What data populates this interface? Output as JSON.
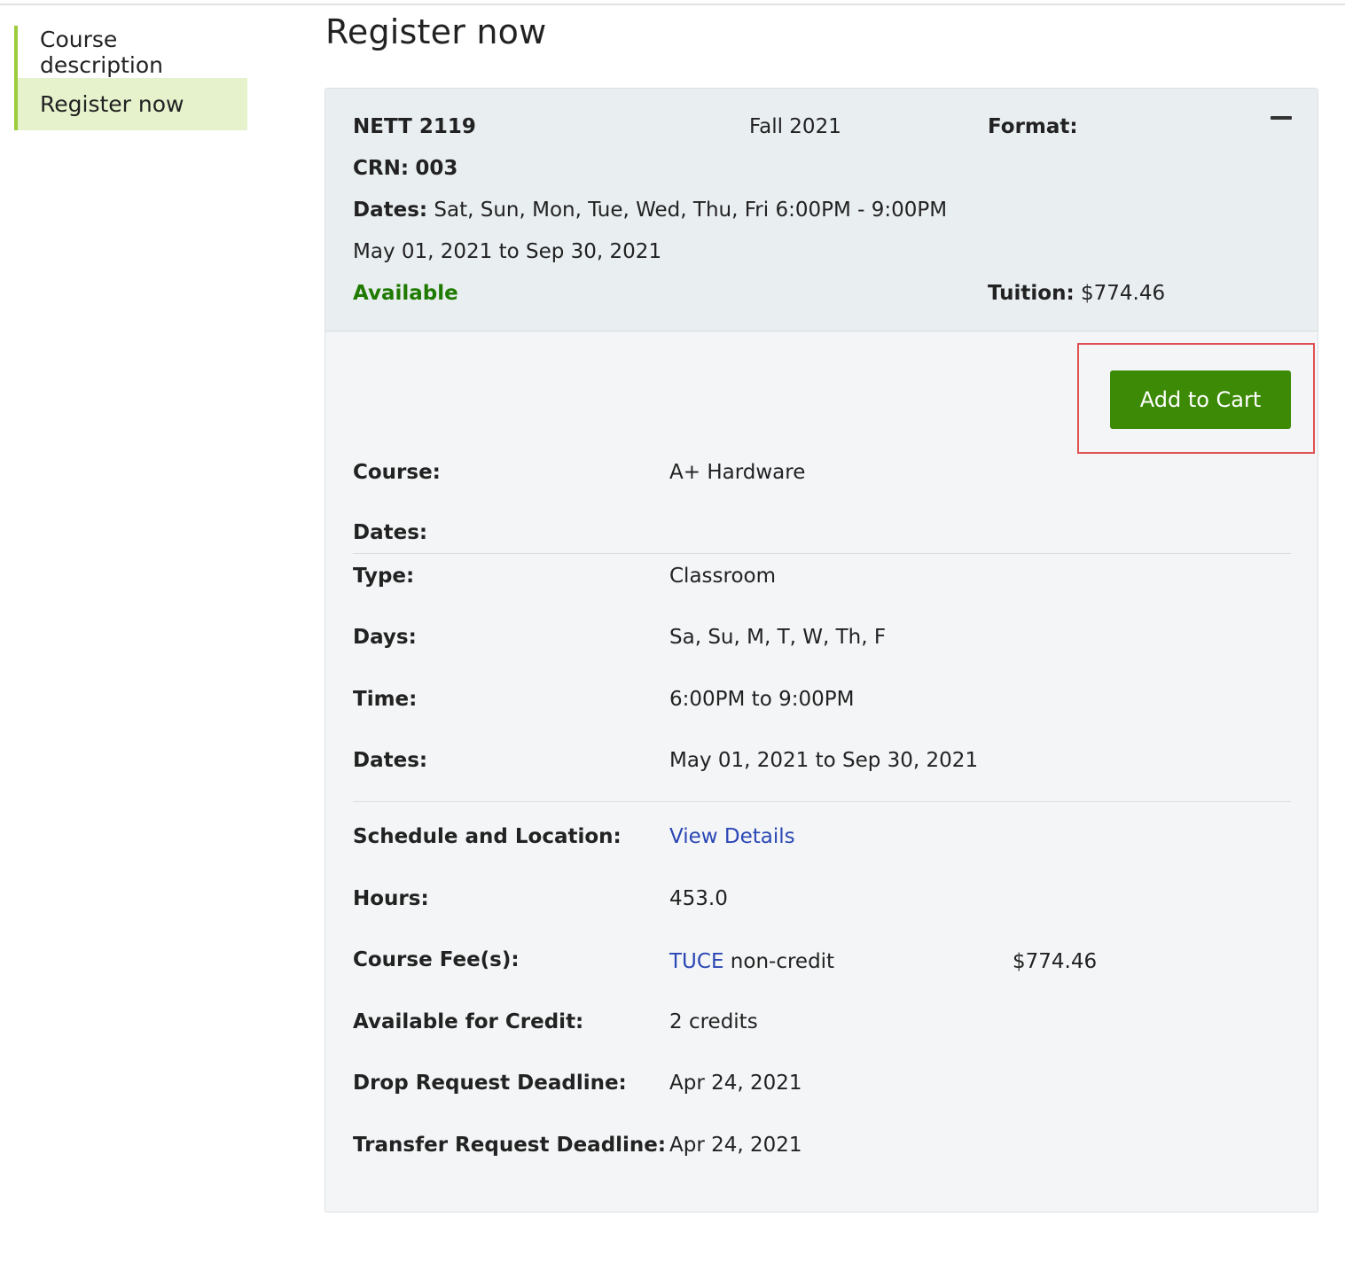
{
  "sidebar": {
    "items": [
      {
        "label": "Course description",
        "active": false
      },
      {
        "label": "Register now",
        "active": true
      }
    ]
  },
  "page": {
    "title": "Register now"
  },
  "section": {
    "course_code": "NETT 2119",
    "term": "Fall 2021",
    "format_label": "Format:",
    "crn_label": "CRN:",
    "crn_value": "003",
    "dates_label": "Dates:",
    "dates_value": "Sat, Sun, Mon, Tue, Wed, Thu, Fri 6:00PM - 9:00PM",
    "date_range": "May 01, 2021 to Sep 30, 2021",
    "status": "Available",
    "tuition_label": "Tuition:",
    "tuition_value": "$774.46"
  },
  "actions": {
    "add_to_cart": "Add to Cart"
  },
  "details": {
    "course_label": "Course:",
    "course_value": "A+ Hardware",
    "dates_label": "Dates:",
    "type_label": "Type:",
    "type_value": "Classroom",
    "days_label": "Days:",
    "days_value": "Sa, Su, M, T, W, Th, F",
    "time_label": "Time:",
    "time_value": "6:00PM to 9:00PM",
    "dates2_label": "Dates:",
    "dates2_value": "May 01, 2021 to Sep 30, 2021",
    "schedule_label": "Schedule and Location:",
    "schedule_link": "View Details",
    "hours_label": "Hours:",
    "hours_value": "453.0",
    "fees_label": "Course Fee(s):",
    "fee_link": "TUCE",
    "fee_type": "non-credit",
    "fee_amount": "$774.46",
    "credit_label": "Available for Credit:",
    "credit_value": "2 credits",
    "drop_label": "Drop Request Deadline:",
    "drop_value": "Apr 24, 2021",
    "transfer_label": "Transfer Request Deadline:",
    "transfer_value": "Apr 24, 2021"
  },
  "colors": {
    "accent_green": "#3d8a06",
    "status_green": "#1f7a00",
    "link_blue": "#2b47b5",
    "sidebar_active_bg": "#e5f2cc",
    "highlight_red": "#e05252"
  },
  "icons": {
    "collapse": "minus-icon"
  }
}
